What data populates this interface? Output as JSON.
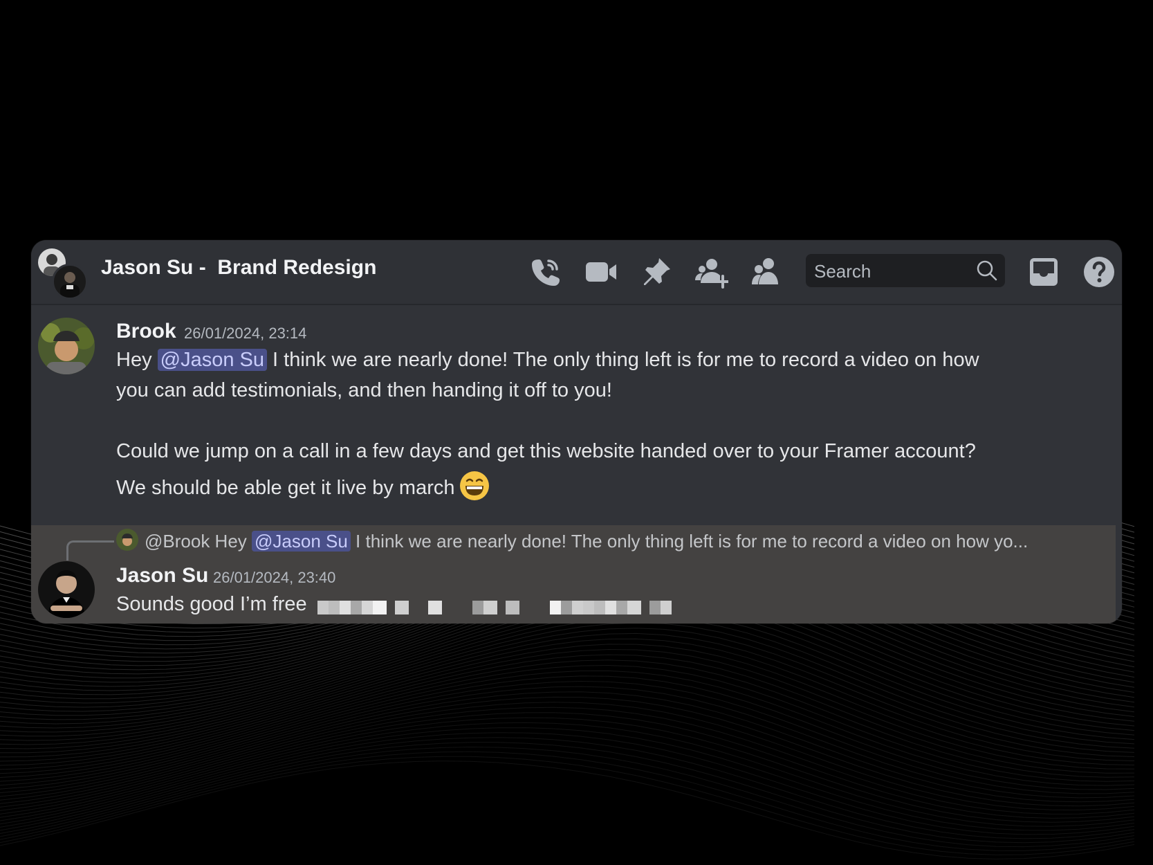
{
  "header": {
    "channel_name": "Jason Su -  Brand Redesign",
    "icons": [
      "phone-call-icon",
      "video-call-icon",
      "pin-icon",
      "add-member-icon",
      "members-icon",
      "inbox-icon",
      "help-icon"
    ],
    "search_placeholder": "Search"
  },
  "messages": [
    {
      "author": "Brook",
      "timestamp": "26/01/2024, 23:14",
      "line1_pre": "Hey ",
      "line1_mention": "@Jason Su",
      "line1_post": " I think we are nearly done! The only thing left is for me to record a video on how",
      "line2": "you can add testimonials, and then handing it off to you!",
      "line3": "Could we jump on a call in a few days and get this website handed over to your Framer account?",
      "line4": "We should be able get it live by march",
      "emoji": "grinning-face-emoji"
    },
    {
      "reply_to": {
        "author": "@Brook",
        "pre": " Hey ",
        "mention": "@Jason Su",
        "post": " I think we are nearly done! The only thing left is for me to record a video on how yo..."
      },
      "author": "Jason Su",
      "timestamp": "26/01/2024, 23:40",
      "text": "Sounds good I’m free"
    }
  ],
  "colors": {
    "window_bg": "#313338",
    "reply_highlight_bg": "#444241",
    "mention_bg": "#4a5089",
    "mention_text": "#c9cdfb"
  }
}
